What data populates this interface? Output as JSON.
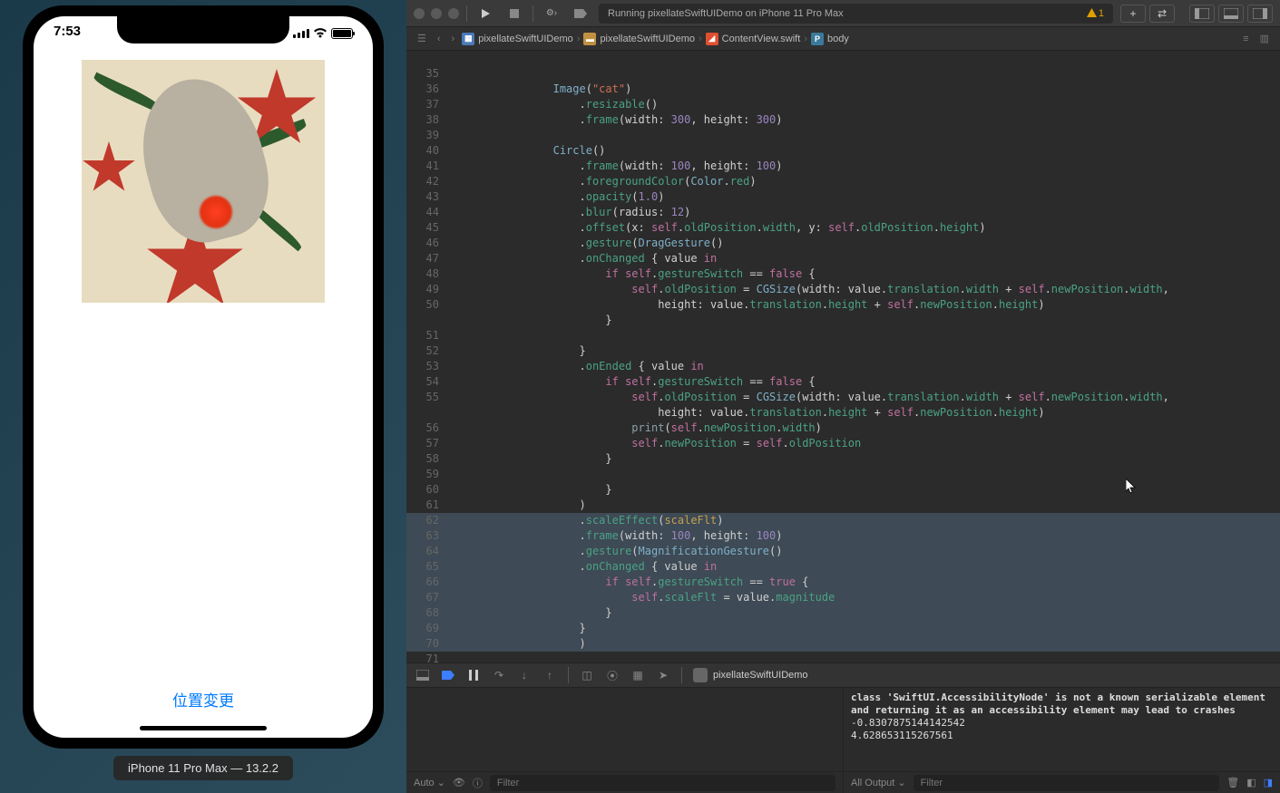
{
  "simulator": {
    "time": "7:53",
    "button_label": "位置変更",
    "device_label": "iPhone 11 Pro Max — 13.2.2"
  },
  "titlebar": {
    "status": "Running pixellateSwiftUIDemo on iPhone 11 Pro Max",
    "warning_count": "1"
  },
  "breadcrumb": {
    "items": [
      {
        "icon": "proj",
        "label": "pixellateSwiftUIDemo"
      },
      {
        "icon": "folder",
        "label": "pixellateSwiftUIDemo"
      },
      {
        "icon": "swift",
        "label": "ContentView.swift"
      },
      {
        "icon": "prop",
        "label": "body"
      }
    ]
  },
  "code": {
    "lines": [
      {
        "n": "",
        "html": ""
      },
      {
        "n": "35",
        "html": ""
      },
      {
        "n": "36",
        "html": "                <span class='type'>Image</span>(<span class='str'>\"cat\"</span>)"
      },
      {
        "n": "37",
        "html": "                    .<span class='fn'>resizable</span>()"
      },
      {
        "n": "38",
        "html": "                    .<span class='fn'>frame</span>(width: <span class='num'>300</span>, height: <span class='num'>300</span>)"
      },
      {
        "n": "39",
        "html": ""
      },
      {
        "n": "40",
        "html": "                <span class='type'>Circle</span>()"
      },
      {
        "n": "41",
        "html": "                    .<span class='fn'>frame</span>(width: <span class='num'>100</span>, height: <span class='num'>100</span>)"
      },
      {
        "n": "42",
        "html": "                    .<span class='fn'>foregroundColor</span>(<span class='type'>Color</span>.<span class='prop'>red</span>)"
      },
      {
        "n": "43",
        "html": "                    .<span class='fn'>opacity</span>(<span class='num'>1.0</span>)"
      },
      {
        "n": "44",
        "html": "                    .<span class='fn'>blur</span>(radius: <span class='num'>12</span>)"
      },
      {
        "n": "45",
        "html": "                    .<span class='fn'>offset</span>(x: <span class='self'>self</span>.<span class='prop'>oldPosition</span>.<span class='prop'>width</span>, y: <span class='self'>self</span>.<span class='prop'>oldPosition</span>.<span class='prop'>height</span>)"
      },
      {
        "n": "46",
        "html": "                    .<span class='fn'>gesture</span>(<span class='type'>DragGesture</span>()"
      },
      {
        "n": "47",
        "html": "                    .<span class='fn'>onChanged</span> { value <span class='kw'>in</span>"
      },
      {
        "n": "48",
        "html": "                        <span class='kw'>if</span> <span class='self'>self</span>.<span class='prop'>gestureSwitch</span> == <span class='bool'>false</span> {"
      },
      {
        "n": "49",
        "html": "                            <span class='self'>self</span>.<span class='prop'>oldPosition</span> = <span class='type'>CGSize</span>(width: value.<span class='prop'>translation</span>.<span class='prop'>width</span> + <span class='self'>self</span>.<span class='prop'>newPosition</span>.<span class='prop'>width</span>,"
      },
      {
        "n": "50",
        "html": "                                height: value.<span class='prop'>translation</span>.<span class='prop'>height</span> + <span class='self'>self</span>.<span class='prop'>newPosition</span>.<span class='prop'>height</span>)"
      },
      {
        "n": "",
        "html": "                        }"
      },
      {
        "n": "51",
        "html": ""
      },
      {
        "n": "52",
        "html": "                    }"
      },
      {
        "n": "53",
        "html": "                    .<span class='fn'>onEnded</span> { value <span class='kw'>in</span>"
      },
      {
        "n": "54",
        "html": "                        <span class='kw'>if</span> <span class='self'>self</span>.<span class='prop'>gestureSwitch</span> == <span class='bool'>false</span> {"
      },
      {
        "n": "55",
        "html": "                            <span class='self'>self</span>.<span class='prop'>oldPosition</span> = <span class='type'>CGSize</span>(width: value.<span class='prop'>translation</span>.<span class='prop'>width</span> + <span class='self'>self</span>.<span class='prop'>newPosition</span>.<span class='prop'>width</span>,"
      },
      {
        "n": "",
        "html": "                                height: value.<span class='prop'>translation</span>.<span class='prop'>height</span> + <span class='self'>self</span>.<span class='prop'>newPosition</span>.<span class='prop'>height</span>)"
      },
      {
        "n": "56",
        "html": "                            <span class='fn2'>print</span>(<span class='self'>self</span>.<span class='prop'>newPosition</span>.<span class='prop'>width</span>)"
      },
      {
        "n": "57",
        "html": "                            <span class='self'>self</span>.<span class='prop'>newPosition</span> = <span class='self'>self</span>.<span class='prop'>oldPosition</span>"
      },
      {
        "n": "58",
        "html": "                        }"
      },
      {
        "n": "59",
        "html": ""
      },
      {
        "n": "60",
        "html": "                        }"
      },
      {
        "n": "61",
        "html": "                    )"
      },
      {
        "n": "62",
        "sel": true,
        "html": "                    .<span class='fn'>scaleEffect</span>(<span class='ident'>scaleFlt</span>)"
      },
      {
        "n": "63",
        "sel": true,
        "html": "                    .<span class='fn'>frame</span>(width: <span class='num'>100</span>, height: <span class='num'>100</span>)"
      },
      {
        "n": "64",
        "sel": true,
        "html": "                    .<span class='fn'>gesture</span>(<span class='type'>MagnificationGesture</span>()"
      },
      {
        "n": "65",
        "sel": true,
        "html": "                    .<span class='fn'>onChanged</span> { value <span class='kw'>in</span>"
      },
      {
        "n": "66",
        "sel": true,
        "html": "                        <span class='kw'>if</span> <span class='self'>self</span>.<span class='prop'>gestureSwitch</span> == <span class='bool'>true</span> {"
      },
      {
        "n": "67",
        "sel": true,
        "html": "                            <span class='self'>self</span>.<span class='prop'>scaleFlt</span> = value.<span class='prop'>magnitude</span>"
      },
      {
        "n": "68",
        "sel": true,
        "html": "                        }"
      },
      {
        "n": "69",
        "sel": true,
        "html": "                    }"
      },
      {
        "n": "70",
        "sel": true,
        "html": "                    )"
      },
      {
        "n": "71",
        "html": ""
      }
    ]
  },
  "debugbar": {
    "target": "pixellateSwiftUIDemo"
  },
  "console": {
    "text": "class 'SwiftUI.AccessibilityNode' is not a known serializable element and returning it as an accessibility element may lead to crashes\n-0.8307875144142542\n4.628653115267561"
  },
  "bottom_toolbar": {
    "auto_label": "Auto",
    "filter_placeholder": "Filter",
    "output_label": "All Output"
  }
}
